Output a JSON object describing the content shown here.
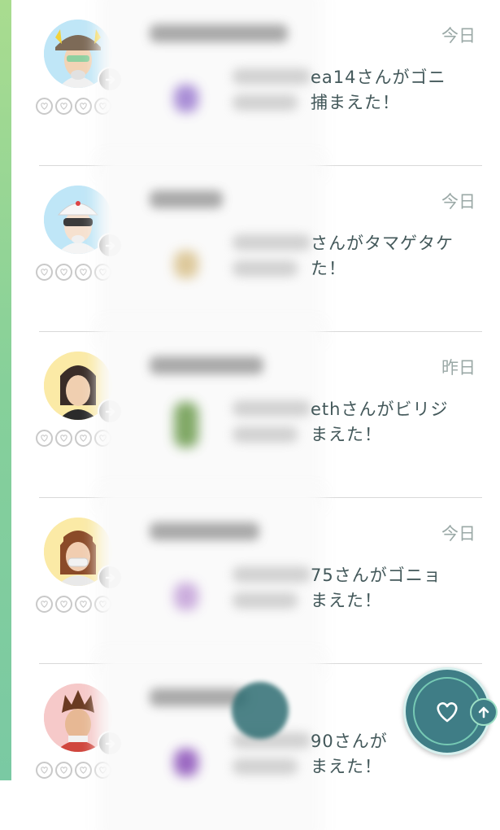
{
  "rows": [
    {
      "date": "今日",
      "message_line1": "ea14さんがゴニ",
      "message_line2": "捕まえた！",
      "avatar": "male-trainer-brown-hat",
      "poke_color": "#9b7bd0"
    },
    {
      "date": "今日",
      "message_line1": "さんがタマゲタケ",
      "message_line2": "た！",
      "avatar": "male-trainer-white-cap-visor",
      "poke_color": "#d8c08a"
    },
    {
      "date": "昨日",
      "message_line1": "ethさんがビリジ",
      "message_line2": "まえた！",
      "avatar": "female-trainer-dark-hair",
      "poke_color": "#6b9a4c"
    },
    {
      "date": "今日",
      "message_line1": "75さんがゴニョ",
      "message_line2": "まえた！",
      "avatar": "female-trainer-brown-hair-mask",
      "poke_color": "#c3a0d8"
    },
    {
      "date": "",
      "message_line1": "90さんが",
      "message_line2": "まえた！",
      "avatar": "male-trainer-spiky-hair",
      "poke_color": "#8a4fb8"
    }
  ],
  "icons": {
    "send_arrow": "arrow-right-icon",
    "friendship_heart": "heart-outline-icon",
    "fab_heart": "heart-icon",
    "fab_up": "arrow-up-icon"
  },
  "colors": {
    "accent": "#3f7d86",
    "date_text": "#9aa8a6",
    "message_text": "#43585a"
  }
}
